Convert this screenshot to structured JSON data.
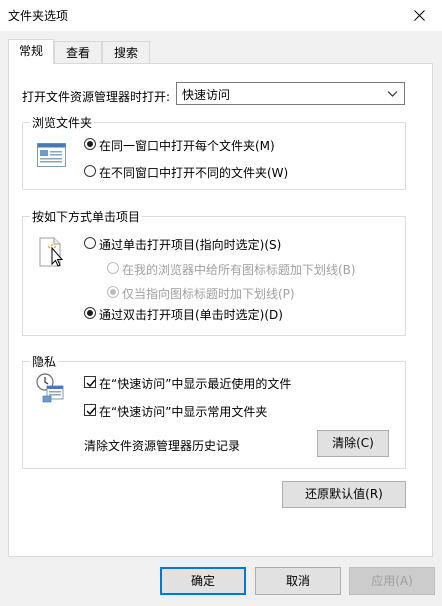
{
  "window": {
    "title": "文件夹选项"
  },
  "tabs": [
    {
      "label": "常规"
    },
    {
      "label": "查看"
    },
    {
      "label": "搜索"
    }
  ],
  "open_explorer": {
    "label": "打开文件资源管理器时打开:",
    "selected": "快速访问"
  },
  "browse_folders": {
    "title": "浏览文件夹",
    "options": [
      {
        "label": "在同一窗口中打开每个文件夹(M)",
        "checked": true
      },
      {
        "label": "在不同窗口中打开不同的文件夹(W)",
        "checked": false
      }
    ]
  },
  "click_items": {
    "title": "按如下方式单击项目",
    "single_click": {
      "label": "通过单击打开项目(指向时选定)(S)",
      "checked": false
    },
    "underline_browser": {
      "label": "在我的浏览器中给所有图标标题加下划线(B)",
      "checked": false,
      "disabled": true
    },
    "underline_hover": {
      "label": "仅当指向图标标题时加下划线(P)",
      "checked": true,
      "disabled": true
    },
    "double_click": {
      "label": "通过双击打开项目(单击时选定)(D)",
      "checked": true
    }
  },
  "privacy": {
    "title": "隐私",
    "show_recent": {
      "label": "在“快速访问”中显示最近使用的文件",
      "checked": true
    },
    "show_frequent": {
      "label": "在“快速访问”中显示常用文件夹",
      "checked": true
    },
    "clear_label": "清除文件资源管理器历史记录",
    "clear_button": "清除(C)"
  },
  "restore_defaults": "还原默认值(R)",
  "footer": {
    "ok": "确定",
    "cancel": "取消",
    "apply": "应用(A)"
  }
}
